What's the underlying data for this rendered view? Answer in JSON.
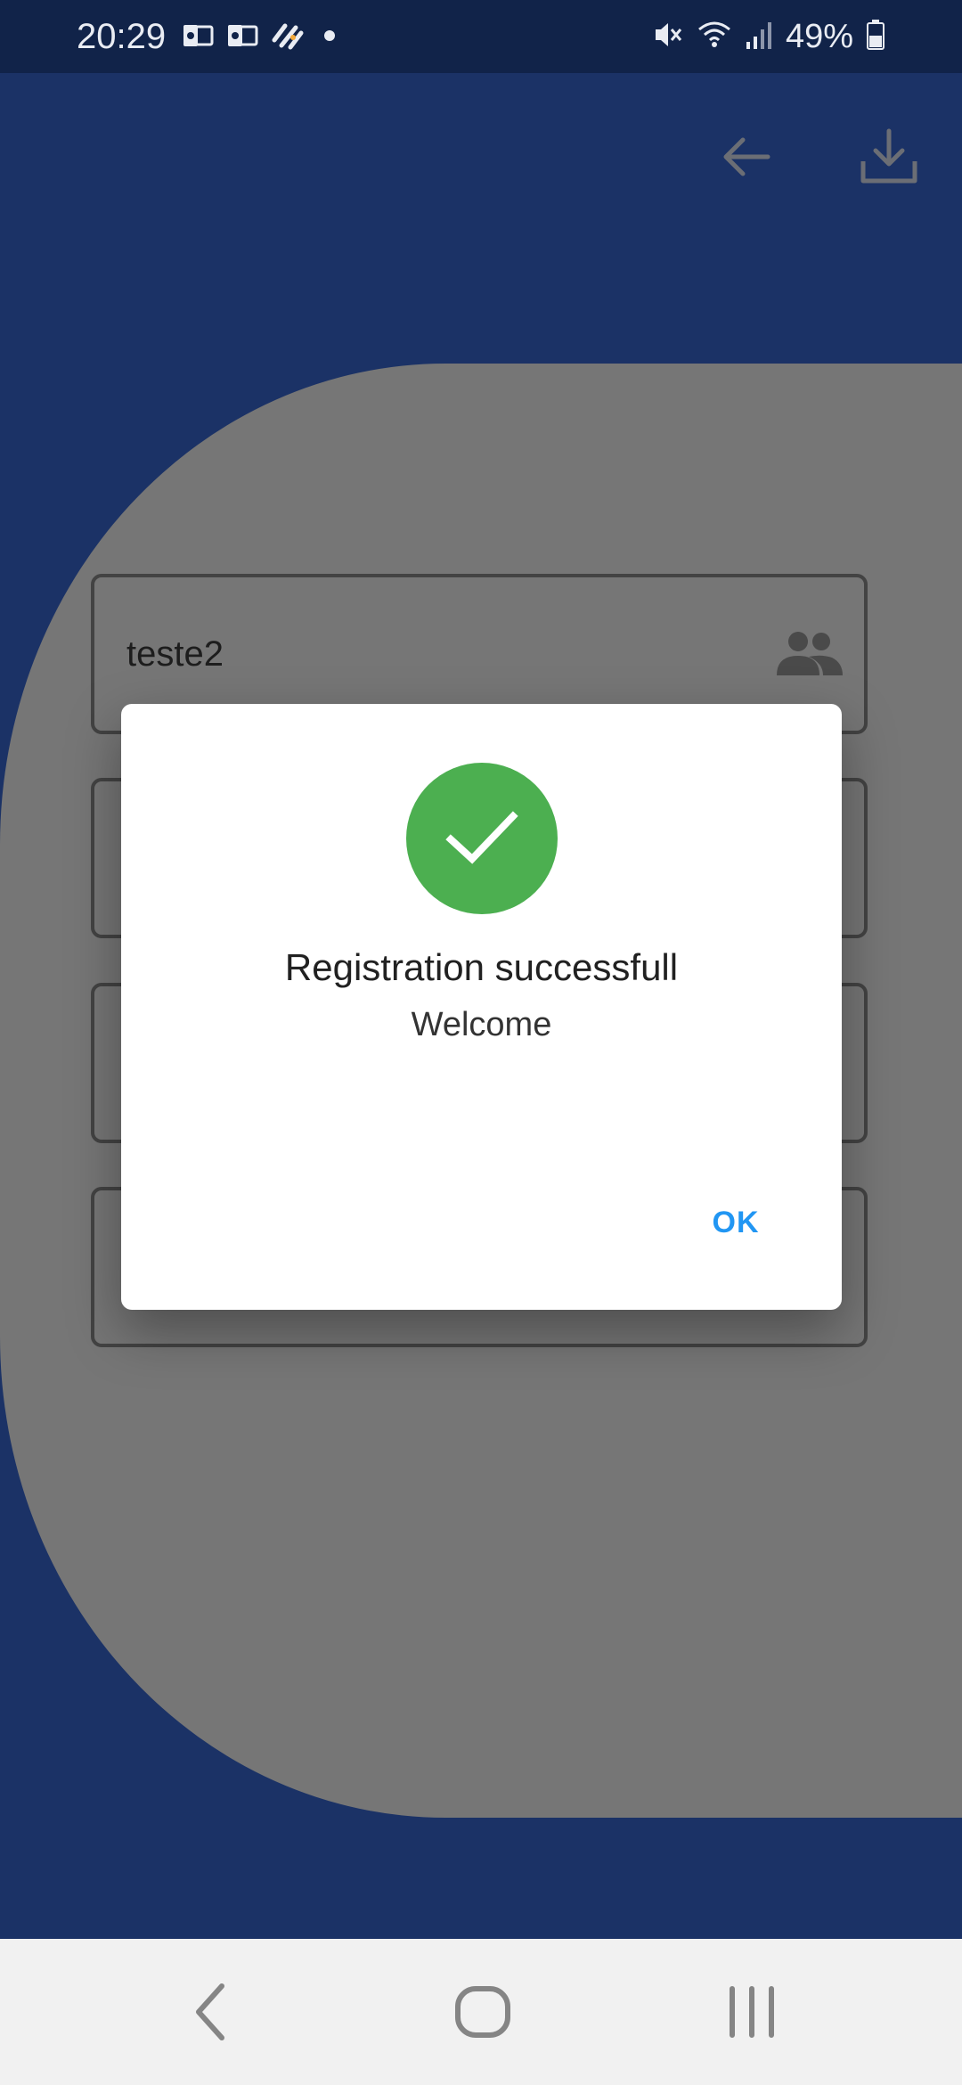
{
  "status_bar": {
    "time": "20:29",
    "battery": "49%",
    "left_icons": [
      "outlook-icon",
      "outlook-icon",
      "app-icon",
      "dot-icon"
    ],
    "right_icons": [
      "mute-icon",
      "wifi-icon",
      "signal-icon",
      "battery-icon"
    ]
  },
  "app_bar": {
    "actions": [
      "back-arrow-icon",
      "download-icon"
    ]
  },
  "form": {
    "fields": [
      {
        "value": "teste2",
        "icon": "group-icon"
      },
      {
        "value": ""
      },
      {
        "value": ""
      },
      {
        "value": ""
      }
    ]
  },
  "dialog": {
    "icon": "check-icon",
    "title": "Registration successfull",
    "subtitle": "Welcome",
    "ok_label": "OK"
  },
  "nav_bar": {
    "buttons": [
      "back-icon",
      "home-icon",
      "recents-icon"
    ]
  },
  "colors": {
    "primary": "#1b3266",
    "status_bar": "#112349",
    "success": "#4caf50",
    "accent": "#2196f3"
  }
}
